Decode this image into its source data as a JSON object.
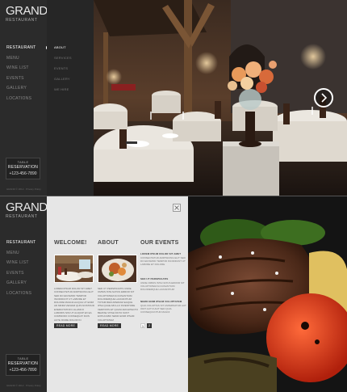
{
  "brand": {
    "name": "GRAND",
    "tagline": "RESTAURANT"
  },
  "nav": [
    "RESTAURANT",
    "MENU",
    "WINE LIST",
    "EVENTS",
    "GALLERY",
    "LOCATIONS"
  ],
  "submenu": [
    "ABOUT",
    "SERVICES",
    "EVENTS",
    "GALLERY",
    "WE HIRE"
  ],
  "reservation": {
    "small": "TABLE",
    "title": "RESERVATION",
    "phone": "+123-456-7890"
  },
  "footer": "GRAND © 2012  ·  Privacy Policy",
  "bottom": {
    "welcome": {
      "heading": "WELCOME!",
      "text": "LOREM IPSUM DOLOR SIT AMET CONSECTETUR ADIPISICING ELIT SED DO EIUSMOD TEMPOR INCIDIDUNT UT LABORE ET DOLORE MAGNA ALIQUA UT ENIM AD MINIM VENIAM QUIS NOSTRUD EXERCITATION ULLAMCO LABORIS NISI UT ALIQUIP EX EA COMMODO CONSEQUAT DUIS AUTE IRURE DOLOR IN REPREHENDERIT IN VOLUPTATE",
      "more": "READ MORE"
    },
    "about": {
      "heading": "ABOUT",
      "text": "SED UT PERSPICIATIS UNDE OMNIS ISTE NATUS ERROR SIT VOLUPTATEM ACCUSANTIUM DOLOREMQUE LAUDANTIUM TOTAM REM APERIAM EAQUE IPSA QUAE AB ILLO INVENTORE VERITATIS ET QUASI ARCHITECTO BEATAE VITAE DICTA SUNT EXPLICABO NEMO ENIM IPSAM VOLUPTATEM",
      "more": "READ MORE"
    },
    "events": {
      "heading": "OUR EVENTS",
      "items": [
        {
          "title": "LOREM IPSUM DOLOR SIT AMET",
          "text": "CONSECTETUR ADIPISICING ELIT SED DO EIUSMOD TEMPOR INCIDIDUNT UT LABORE ET DOLORE"
        },
        {
          "title": "SED UT PERSPICIATIS",
          "text": "UNDE OMNIS ISTE NATUS ERROR SIT VOLUPTATEM ACCUSANTIUM DOLOREMQUE LAUDANTIUM"
        },
        {
          "title": "NEMO ENIM IPSAM VOLUPTATEM",
          "text": "QUIA VOLUPTAS SIT ASPERNATUR AUT ODIT AUT FUGIT SED QUIA CONSEQUUNTUR MAGNI"
        }
      ],
      "pages": [
        "1",
        "2"
      ]
    }
  }
}
